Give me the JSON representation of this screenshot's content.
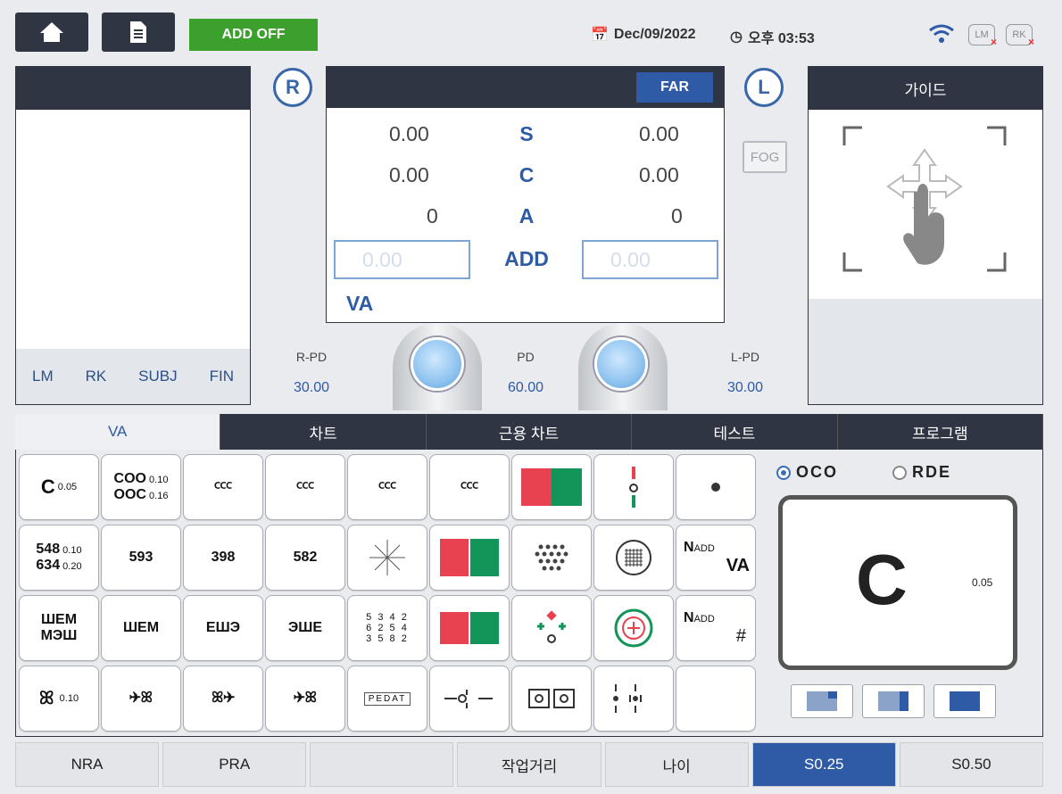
{
  "topbar": {
    "add_label": "ADD OFF",
    "date": "Dec/09/2022",
    "time": "오후 03:53",
    "badge_lm": "LM",
    "badge_rk": "RK"
  },
  "left_panel": {
    "footer": [
      "LM",
      "RK",
      "SUBJ",
      "FIN"
    ]
  },
  "eyes": {
    "right": "R",
    "left": "L"
  },
  "center": {
    "mode": "FAR",
    "right": {
      "s": "0.00",
      "c": "0.00",
      "a": "0",
      "add": "0.00"
    },
    "left": {
      "s": "0.00",
      "c": "0.00",
      "a": "0",
      "add": "0.00"
    },
    "labels": {
      "s": "S",
      "c": "C",
      "a": "A",
      "add": "ADD"
    },
    "va": "VA"
  },
  "fog": "FOG",
  "guide": {
    "title": "가이드"
  },
  "pd": {
    "r_label": "R-PD",
    "r_value": "30.00",
    "label": "PD",
    "value": "60.00",
    "l_label": "L-PD",
    "l_value": "30.00"
  },
  "tabs": [
    "VA",
    "차트",
    "근용 차트",
    "테스트",
    "프로그램"
  ],
  "chart_cells": {
    "c005": "0.05",
    "c010": "0.10",
    "c016": "0.16",
    "num1": "548",
    "num2": "634",
    "n010": "0.10",
    "n020": "0.20",
    "letters_a": "ШEМ",
    "letters_b": "МЭШ",
    "bf": "0.10",
    "nadd": "N",
    "add": "ADD",
    "va": "VA",
    "digits": [
      "5 3 4 2",
      "6 2 5 4",
      "3 5 8 2"
    ],
    "pedat": "PEDAT"
  },
  "preview": {
    "opt1": "OCO",
    "opt2": "RDE",
    "value": "0.05"
  },
  "bottom": [
    "NRA",
    "PRA",
    "",
    "작업거리",
    "나이",
    "S0.25",
    "S0.50"
  ],
  "colors": {
    "dark": "#2f3542",
    "accent": "#2e5aa6",
    "green": "#3ba12c"
  }
}
